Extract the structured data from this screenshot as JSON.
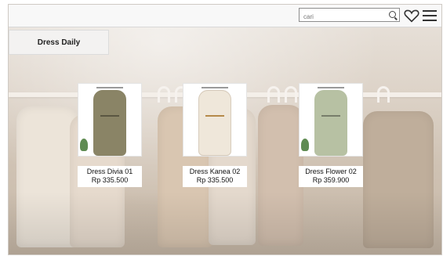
{
  "header": {
    "search_placeholder": "cari",
    "icons": [
      "search-icon",
      "heart-icon",
      "menu-icon"
    ]
  },
  "category": {
    "title": "Dress Daily"
  },
  "products": [
    {
      "name": "Dress Divia 01",
      "price": "Rp 335.500",
      "dress_color": "#8a8466"
    },
    {
      "name": "Dress Kanea 02",
      "price": "Rp 335.500",
      "dress_color": "#efe7da"
    },
    {
      "name": "Dress Flower 02",
      "price": "Rp 359.900",
      "dress_color": "#b7c1a3"
    }
  ],
  "colors": {
    "header_bg": "#f8f8f8",
    "background_tone": "#cfc2b3"
  }
}
